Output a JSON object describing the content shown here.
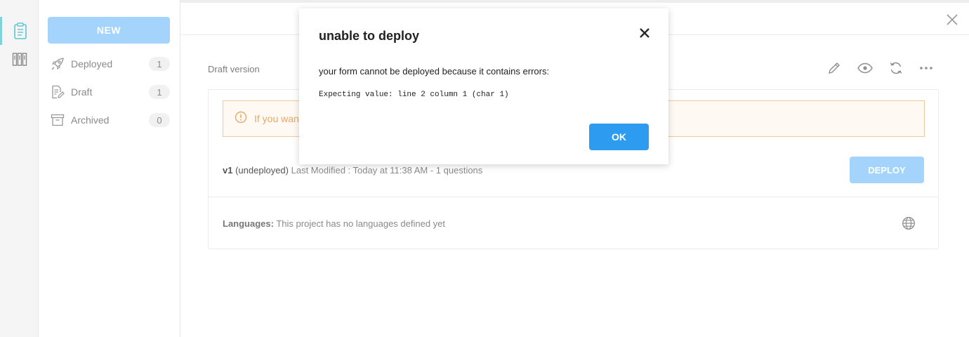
{
  "rail": {
    "items": [
      {
        "icon": "clipboard-icon",
        "active": true
      },
      {
        "icon": "library-icon",
        "active": false
      }
    ]
  },
  "sidebar": {
    "new_label": "NEW",
    "items": [
      {
        "icon": "rocket-icon",
        "label": "Deployed",
        "count": "1"
      },
      {
        "icon": "draft-icon",
        "label": "Draft",
        "count": "1"
      },
      {
        "icon": "archive-icon",
        "label": "Archived",
        "count": "0"
      }
    ]
  },
  "main": {
    "draft_label": "Draft version",
    "warning_text": "If you want",
    "version": {
      "name": "v1",
      "status": "(undeployed)",
      "meta": "Last Modified : Today at 11:38 AM - 1 questions"
    },
    "deploy_label": "DEPLOY",
    "languages_label": "Languages:",
    "languages_text": "This project has no languages defined yet"
  },
  "modal": {
    "title": "unable to deploy",
    "message": "your form cannot be deployed because it contains errors:",
    "code": "Expecting value: line 2 column 1 (char 1)",
    "ok_label": "OK"
  },
  "colors": {
    "accent": "#2d9cf0",
    "accent_light": "#a4d4fb",
    "warning_border": "#f5c79d",
    "warning_text": "#e7a86a",
    "rail_active": "#7fd3d9"
  }
}
